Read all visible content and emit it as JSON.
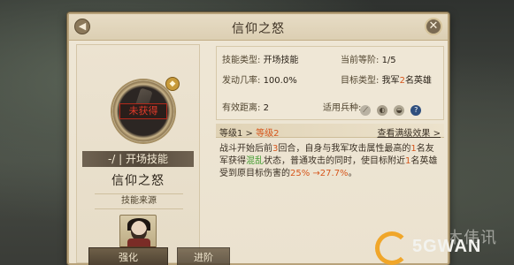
{
  "window": {
    "title": "信仰之怒",
    "back_icon": "back-icon",
    "close_icon": "✕"
  },
  "skill": {
    "status": "未获得",
    "lock_icon": "◆",
    "type_banner": "-/ | 开场技能",
    "name": "信仰之怒",
    "source_label": "技能来源",
    "hero_stars": "★★★★★"
  },
  "attributes": {
    "skill_type_label": "技能类型:",
    "skill_type_value": "开场技能",
    "current_level_label": "当前等阶:",
    "current_level_value": "1/5",
    "activation_label": "发动几率:",
    "activation_value": "100.0%",
    "target_type_label": "目标类型:",
    "target_type_value_pre": "我军",
    "target_type_value_hl": "2",
    "target_type_value_post": "名英雄",
    "effective_range_label": "有效距离:",
    "effective_range_value": "2",
    "troops_label": "适用兵种:",
    "troop_icons": [
      "spear-icon",
      "bow-icon",
      "horse-icon",
      "help-icon"
    ]
  },
  "level": {
    "prefix": "等级1 >",
    "current": "等级2",
    "link": "查看满级效果 >"
  },
  "description": {
    "p1": "战斗开始后前",
    "p1_hl": "3",
    "p2": "回合，自身与我军攻击属性最高的",
    "p2_hl": "1",
    "p3": "名友军获得",
    "p3_gr": "混乱",
    "p4": "状态，普通攻击的同时，使目标附近",
    "p4_hl": "1",
    "p5": "名英雄受到原目标伤害的",
    "p5_hl": "25% →27.7%",
    "p6": "。"
  },
  "tabs": {
    "strengthen": "强化",
    "advance": "进阶"
  },
  "watermark": {
    "text": "5GWAN",
    "scribble": "木伟讯"
  }
}
